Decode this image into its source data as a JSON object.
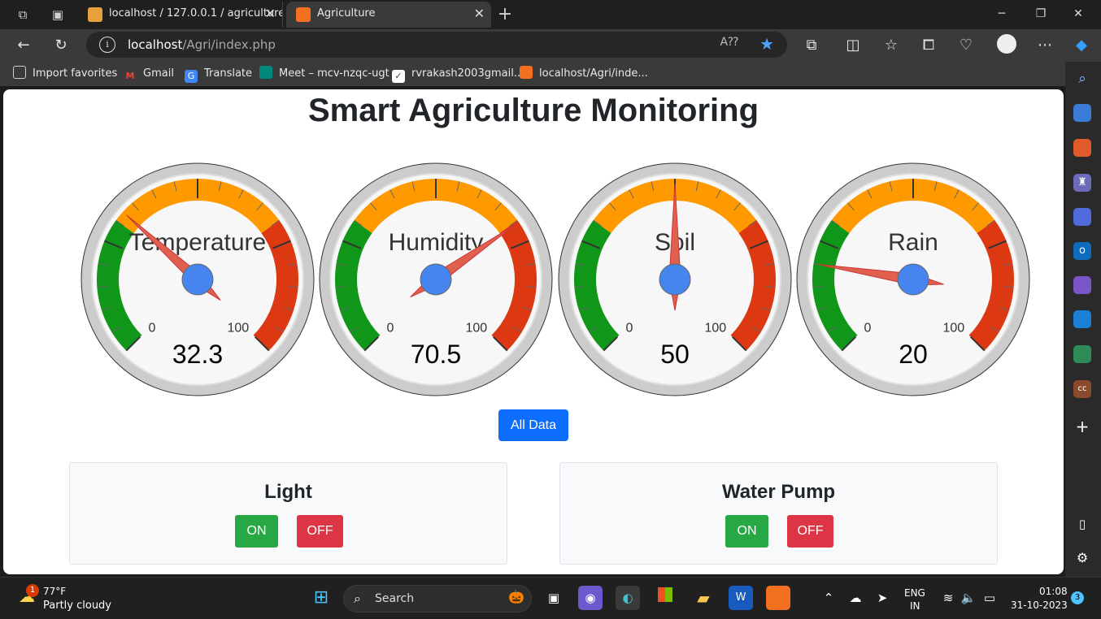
{
  "browser": {
    "tabs": [
      {
        "title": "localhost / 127.0.0.1 / agriculture"
      },
      {
        "title": "Agriculture"
      }
    ],
    "url_host": "localhost",
    "url_path": "/Agri/index.php",
    "favorites": [
      {
        "label": "Import favorites"
      },
      {
        "label": "Gmail"
      },
      {
        "label": "Translate"
      },
      {
        "label": "Meet – mcv-nzqc-ugt"
      },
      {
        "label": "rvrakash2003gmail..."
      },
      {
        "label": "localhost/Agri/inde..."
      }
    ]
  },
  "page": {
    "title": "Smart Agriculture Monitoring",
    "gauges": [
      {
        "label": "Temperature",
        "value": 32.3,
        "display": "32.3",
        "min": 0,
        "max": 100,
        "min_label": "0",
        "max_label": "100"
      },
      {
        "label": "Humidity",
        "value": 70.5,
        "display": "70.5",
        "min": 0,
        "max": 100,
        "min_label": "0",
        "max_label": "100"
      },
      {
        "label": "Soil",
        "value": 50,
        "display": "50",
        "min": 0,
        "max": 100,
        "min_label": "0",
        "max_label": "100"
      },
      {
        "label": "Rain",
        "value": 20,
        "display": "20",
        "min": 0,
        "max": 100,
        "min_label": "0",
        "max_label": "100"
      }
    ],
    "gauge_colors": {
      "green": "#109618",
      "orange": "#FF9900",
      "red": "#DC3912",
      "needle": "#e06050",
      "hub": "#4684ee"
    },
    "all_data_label": "All Data",
    "controls": [
      {
        "title": "Light",
        "on_label": "ON",
        "off_label": "OFF"
      },
      {
        "title": "Water Pump",
        "on_label": "ON",
        "off_label": "OFF"
      }
    ]
  },
  "taskbar": {
    "weather_temp": "77°F",
    "weather_desc": "Partly cloudy",
    "weather_badge": "1",
    "search_label": "Search",
    "lang_line1": "ENG",
    "lang_line2": "IN",
    "time": "01:08",
    "date": "31-10-2023",
    "notif_count": "3"
  }
}
